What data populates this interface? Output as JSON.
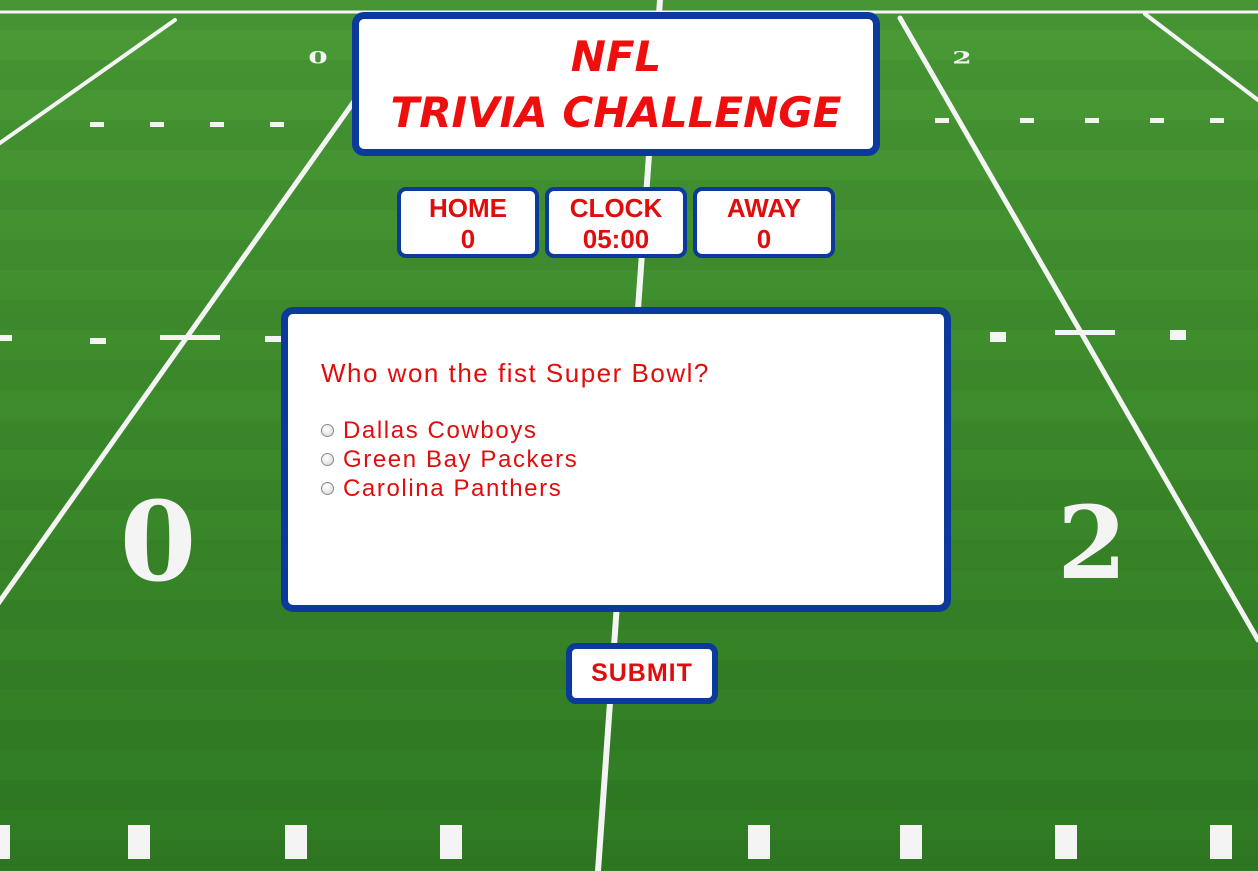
{
  "header": {
    "title_line1": "NFL",
    "title_line2": "TRIVIA CHALLENGE"
  },
  "scoreboard": {
    "home": {
      "label": "HOME",
      "value": "0"
    },
    "clock": {
      "label": "CLOCK",
      "value": "05:00"
    },
    "away": {
      "label": "AWAY",
      "value": "0"
    }
  },
  "question": {
    "text": "Who won the fist Super Bowl?",
    "options": [
      {
        "label": "Dallas Cowboys",
        "selected": false
      },
      {
        "label": "Green Bay Packers",
        "selected": false
      },
      {
        "label": "Carolina Panthers",
        "selected": false
      }
    ]
  },
  "submit": {
    "label": "SUBMIT"
  },
  "field": {
    "left_number": "0",
    "right_number": "2"
  },
  "colors": {
    "border": "#0b3a9c",
    "text": "#e00d0d",
    "field": "#3c8a2c",
    "lines": "#ffffff"
  }
}
